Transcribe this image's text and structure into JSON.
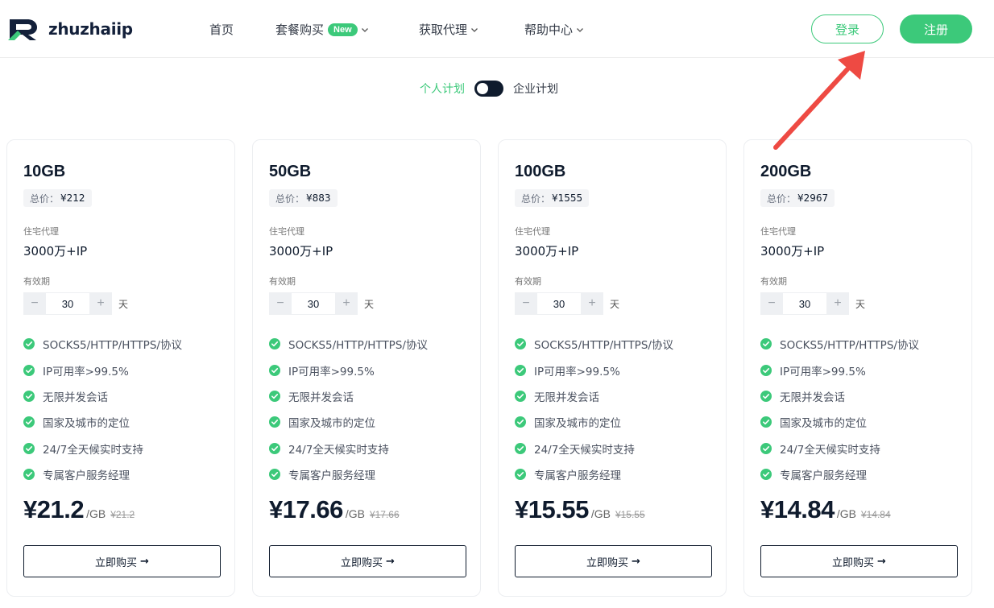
{
  "brand": {
    "name": "zhuzhaiip",
    "accent": "#3cc97a",
    "dark": "#0f1b2d"
  },
  "nav": {
    "home": "首页",
    "packages": "套餐购买",
    "new_badge": "New",
    "get_proxy": "获取代理",
    "help": "帮助中心"
  },
  "auth": {
    "login": "登录",
    "register": "注册"
  },
  "plan_toggle": {
    "personal": "个人计划",
    "enterprise": "企业计划"
  },
  "cards": [
    {
      "title": "10GB",
      "total_label": "总价：",
      "total_value": "¥212",
      "proxy_type": "住宅代理",
      "ip_count": "3000万+IP",
      "validity_label": "有效期",
      "days": "30",
      "days_unit": "天",
      "price": "¥21.2",
      "per_unit": "/GB",
      "old_price": "¥21.2",
      "buy": "立即购买"
    },
    {
      "title": "50GB",
      "total_label": "总价：",
      "total_value": "¥883",
      "proxy_type": "住宅代理",
      "ip_count": "3000万+IP",
      "validity_label": "有效期",
      "days": "30",
      "days_unit": "天",
      "price": "¥17.66",
      "per_unit": "/GB",
      "old_price": "¥17.66",
      "buy": "立即购买"
    },
    {
      "title": "100GB",
      "total_label": "总价：",
      "total_value": "¥1555",
      "proxy_type": "住宅代理",
      "ip_count": "3000万+IP",
      "validity_label": "有效期",
      "days": "30",
      "days_unit": "天",
      "price": "¥15.55",
      "per_unit": "/GB",
      "old_price": "¥15.55",
      "buy": "立即购买"
    },
    {
      "title": "200GB",
      "total_label": "总价：",
      "total_value": "¥2967",
      "proxy_type": "住宅代理",
      "ip_count": "3000万+IP",
      "validity_label": "有效期",
      "days": "30",
      "days_unit": "天",
      "price": "¥14.84",
      "per_unit": "/GB",
      "old_price": "¥14.84",
      "buy": "立即购买"
    }
  ],
  "features": [
    "SOCKS5/HTTP/HTTPS/协议",
    "IP可用率>99.5%",
    "无限并发会话",
    "国家及城市的定位",
    "24/7全天候实时支持",
    "专属客户服务经理"
  ],
  "stepper": {
    "minus": "−",
    "plus": "+"
  },
  "icons": {
    "check": "check-circle-icon",
    "chevron": "chevron-down-icon",
    "arrow": "arrow-right-icon"
  },
  "annotation": {
    "arrow_color": "#ee4a43"
  }
}
